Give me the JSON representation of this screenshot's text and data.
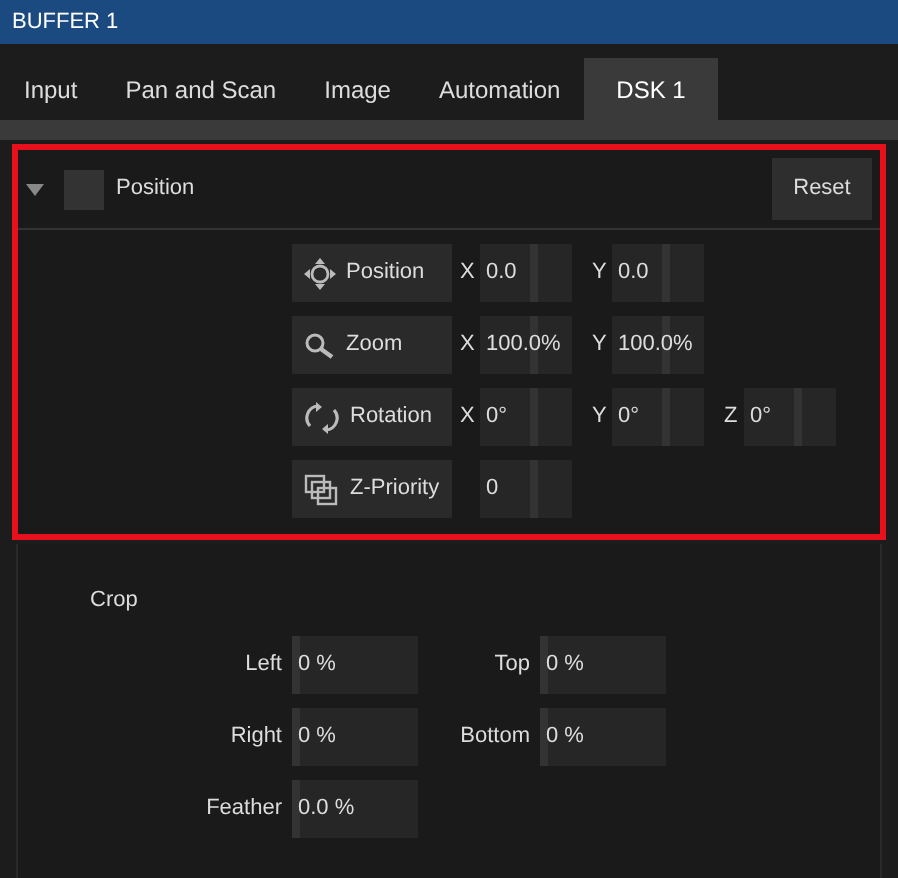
{
  "window": {
    "title": "BUFFER 1"
  },
  "tabs": [
    {
      "label": "Input",
      "selected": false
    },
    {
      "label": "Pan and Scan",
      "selected": false
    },
    {
      "label": "Image",
      "selected": false
    },
    {
      "label": "Automation",
      "selected": false
    },
    {
      "label": "DSK 1",
      "selected": true
    }
  ],
  "position_section": {
    "title": "Position",
    "expanded": true,
    "checked": false,
    "reset_button": "Reset",
    "rows": [
      {
        "kind": "position",
        "button": "Position",
        "fields": [
          {
            "axis": "X",
            "value": "0.0"
          },
          {
            "axis": "Y",
            "value": "0.0"
          }
        ]
      },
      {
        "kind": "zoom",
        "button": "Zoom",
        "fields": [
          {
            "axis": "X",
            "value": "100.0%"
          },
          {
            "axis": "Y",
            "value": "100.0%"
          }
        ]
      },
      {
        "kind": "rotation",
        "button": "Rotation",
        "fields": [
          {
            "axis": "X",
            "value": "0°"
          },
          {
            "axis": "Y",
            "value": "0°"
          },
          {
            "axis": "Z",
            "value": "0°"
          }
        ]
      },
      {
        "kind": "priority",
        "button": "Z-Priority",
        "fields": [
          {
            "value": "0"
          }
        ]
      }
    ]
  },
  "crop_section": {
    "title": "Crop",
    "rows": [
      [
        {
          "label": "Left",
          "value": "0 %"
        },
        {
          "label": "Top",
          "value": "0 %"
        }
      ],
      [
        {
          "label": "Right",
          "value": "0 %"
        },
        {
          "label": "Bottom",
          "value": "0 %"
        }
      ],
      [
        {
          "label": "Feather",
          "value": "0.0 %"
        }
      ]
    ]
  }
}
